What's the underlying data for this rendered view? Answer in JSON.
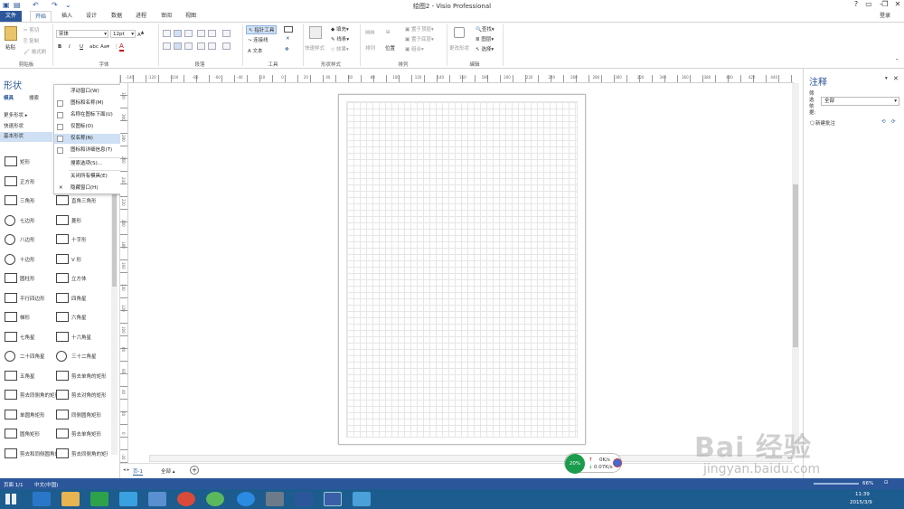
{
  "window": {
    "title": "绘图2 - Visio Professional",
    "help": "?",
    "login": "登录"
  },
  "tabs": [
    "文件",
    "开始",
    "插入",
    "设计",
    "数据",
    "进程",
    "审阅",
    "视图"
  ],
  "ribbon": {
    "clipboard": {
      "paste": "粘贴",
      "cut": "剪切",
      "copy": "复制",
      "format_painter": "格式刷",
      "label": "剪贴板"
    },
    "font": {
      "name": "宋体",
      "size": "12pt",
      "label": "字体"
    },
    "paragraph": {
      "label": "段落"
    },
    "tools": {
      "pointer": "指针工具",
      "connector": "连接线",
      "text": "文本",
      "label": "工具"
    },
    "shape_styles": {
      "quick": "快速样式",
      "fill": "填充",
      "line": "线条",
      "effects": "效果",
      "label": "形状样式"
    },
    "arrange": {
      "align": "排列",
      "position": "位置",
      "to_top": "置于顶层",
      "to_bottom": "置于底层",
      "group": "组合",
      "label": "排列"
    },
    "editing": {
      "change_shape": "更改形状",
      "find": "查找",
      "layers": "图层",
      "select": "选择",
      "label": "编辑"
    }
  },
  "shapes_panel": {
    "title": "形状",
    "tab_stencils": "模具",
    "tab_search": "搜索",
    "more": "更多形状",
    "quick": "快速形状",
    "basic": "基本形状",
    "items": [
      "矩形",
      "圆形",
      "正方形",
      "椭圆形",
      "三角形",
      "直角三角形",
      "七边形",
      "菱形",
      "八边形",
      "十字形",
      "十边形",
      "V 形",
      "圆柱形",
      "立方体",
      "平行四边形",
      "四角星",
      "梯形",
      "六角星",
      "七角星",
      "十六角星",
      "二十四角星",
      "三十二角星",
      "五角星",
      "剪去单角的矩形",
      "剪去同侧角的矩形",
      "剪去对角的矩形",
      "单圆角矩形",
      "同侧圆角矩形",
      "圆角矩形",
      "剪去单角矩形",
      "剪去和同侧圆角的矩形",
      "剪去同侧角的矩形"
    ]
  },
  "context_menu": [
    "浮动窗口(W)",
    "图标和名称(M)",
    "名称在图标下面(U)",
    "仅图标(O)",
    "仅名称(N)",
    "图标和详细信息(T)",
    "搜索选项(S)...",
    "关闭所有模具(E)",
    "隐藏窗口(H)"
  ],
  "ruler_top": [
    "-140",
    "-120",
    "-100",
    "-80",
    "-60",
    "-40",
    "-20",
    "0",
    "20",
    "40",
    "60",
    "80",
    "100",
    "120",
    "140",
    "160",
    "180",
    "200",
    "220",
    "240",
    "260",
    "280",
    "300",
    "320",
    "340",
    "360",
    "380",
    "400",
    "420",
    "440"
  ],
  "ruler_left": [
    "320",
    "300",
    "280",
    "260",
    "240",
    "220",
    "200",
    "180",
    "160",
    "140",
    "120",
    "100",
    "80",
    "60",
    "40",
    "20",
    "0",
    "-20"
  ],
  "page_tabs": {
    "page": "页-1",
    "all": "全部 ▴",
    "add": "+"
  },
  "notes": {
    "title": "注释",
    "filter_label": "筛选依据:",
    "filter_value": "全部",
    "new_comment": "新建批注"
  },
  "status": {
    "page": "页面 1/1",
    "lang": "中文(中国)",
    "zoom": "66%"
  },
  "net": {
    "percent": "20%",
    "up": "0K/s",
    "down": "0.07K/s"
  },
  "clock": {
    "time": "11:39",
    "date": "2015/3/9"
  },
  "watermark": {
    "brand": "Bai  经验",
    "url": "jingyan.baidu.com"
  }
}
